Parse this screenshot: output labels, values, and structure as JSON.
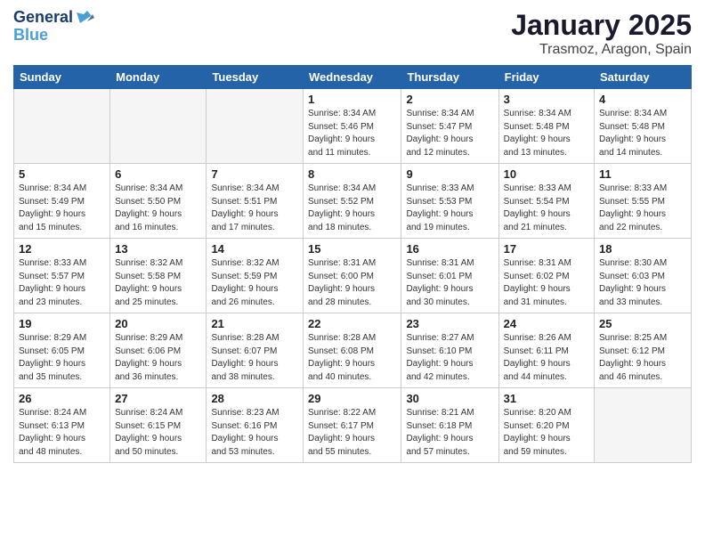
{
  "logo": {
    "line1": "General",
    "line2": "Blue"
  },
  "title": "January 2025",
  "subtitle": "Trasmoz, Aragon, Spain",
  "days_of_week": [
    "Sunday",
    "Monday",
    "Tuesday",
    "Wednesday",
    "Thursday",
    "Friday",
    "Saturday"
  ],
  "weeks": [
    [
      {
        "day": "",
        "info": ""
      },
      {
        "day": "",
        "info": ""
      },
      {
        "day": "",
        "info": ""
      },
      {
        "day": "1",
        "info": "Sunrise: 8:34 AM\nSunset: 5:46 PM\nDaylight: 9 hours\nand 11 minutes."
      },
      {
        "day": "2",
        "info": "Sunrise: 8:34 AM\nSunset: 5:47 PM\nDaylight: 9 hours\nand 12 minutes."
      },
      {
        "day": "3",
        "info": "Sunrise: 8:34 AM\nSunset: 5:48 PM\nDaylight: 9 hours\nand 13 minutes."
      },
      {
        "day": "4",
        "info": "Sunrise: 8:34 AM\nSunset: 5:48 PM\nDaylight: 9 hours\nand 14 minutes."
      }
    ],
    [
      {
        "day": "5",
        "info": "Sunrise: 8:34 AM\nSunset: 5:49 PM\nDaylight: 9 hours\nand 15 minutes."
      },
      {
        "day": "6",
        "info": "Sunrise: 8:34 AM\nSunset: 5:50 PM\nDaylight: 9 hours\nand 16 minutes."
      },
      {
        "day": "7",
        "info": "Sunrise: 8:34 AM\nSunset: 5:51 PM\nDaylight: 9 hours\nand 17 minutes."
      },
      {
        "day": "8",
        "info": "Sunrise: 8:34 AM\nSunset: 5:52 PM\nDaylight: 9 hours\nand 18 minutes."
      },
      {
        "day": "9",
        "info": "Sunrise: 8:33 AM\nSunset: 5:53 PM\nDaylight: 9 hours\nand 19 minutes."
      },
      {
        "day": "10",
        "info": "Sunrise: 8:33 AM\nSunset: 5:54 PM\nDaylight: 9 hours\nand 21 minutes."
      },
      {
        "day": "11",
        "info": "Sunrise: 8:33 AM\nSunset: 5:55 PM\nDaylight: 9 hours\nand 22 minutes."
      }
    ],
    [
      {
        "day": "12",
        "info": "Sunrise: 8:33 AM\nSunset: 5:57 PM\nDaylight: 9 hours\nand 23 minutes."
      },
      {
        "day": "13",
        "info": "Sunrise: 8:32 AM\nSunset: 5:58 PM\nDaylight: 9 hours\nand 25 minutes."
      },
      {
        "day": "14",
        "info": "Sunrise: 8:32 AM\nSunset: 5:59 PM\nDaylight: 9 hours\nand 26 minutes."
      },
      {
        "day": "15",
        "info": "Sunrise: 8:31 AM\nSunset: 6:00 PM\nDaylight: 9 hours\nand 28 minutes."
      },
      {
        "day": "16",
        "info": "Sunrise: 8:31 AM\nSunset: 6:01 PM\nDaylight: 9 hours\nand 30 minutes."
      },
      {
        "day": "17",
        "info": "Sunrise: 8:31 AM\nSunset: 6:02 PM\nDaylight: 9 hours\nand 31 minutes."
      },
      {
        "day": "18",
        "info": "Sunrise: 8:30 AM\nSunset: 6:03 PM\nDaylight: 9 hours\nand 33 minutes."
      }
    ],
    [
      {
        "day": "19",
        "info": "Sunrise: 8:29 AM\nSunset: 6:05 PM\nDaylight: 9 hours\nand 35 minutes."
      },
      {
        "day": "20",
        "info": "Sunrise: 8:29 AM\nSunset: 6:06 PM\nDaylight: 9 hours\nand 36 minutes."
      },
      {
        "day": "21",
        "info": "Sunrise: 8:28 AM\nSunset: 6:07 PM\nDaylight: 9 hours\nand 38 minutes."
      },
      {
        "day": "22",
        "info": "Sunrise: 8:28 AM\nSunset: 6:08 PM\nDaylight: 9 hours\nand 40 minutes."
      },
      {
        "day": "23",
        "info": "Sunrise: 8:27 AM\nSunset: 6:10 PM\nDaylight: 9 hours\nand 42 minutes."
      },
      {
        "day": "24",
        "info": "Sunrise: 8:26 AM\nSunset: 6:11 PM\nDaylight: 9 hours\nand 44 minutes."
      },
      {
        "day": "25",
        "info": "Sunrise: 8:25 AM\nSunset: 6:12 PM\nDaylight: 9 hours\nand 46 minutes."
      }
    ],
    [
      {
        "day": "26",
        "info": "Sunrise: 8:24 AM\nSunset: 6:13 PM\nDaylight: 9 hours\nand 48 minutes."
      },
      {
        "day": "27",
        "info": "Sunrise: 8:24 AM\nSunset: 6:15 PM\nDaylight: 9 hours\nand 50 minutes."
      },
      {
        "day": "28",
        "info": "Sunrise: 8:23 AM\nSunset: 6:16 PM\nDaylight: 9 hours\nand 53 minutes."
      },
      {
        "day": "29",
        "info": "Sunrise: 8:22 AM\nSunset: 6:17 PM\nDaylight: 9 hours\nand 55 minutes."
      },
      {
        "day": "30",
        "info": "Sunrise: 8:21 AM\nSunset: 6:18 PM\nDaylight: 9 hours\nand 57 minutes."
      },
      {
        "day": "31",
        "info": "Sunrise: 8:20 AM\nSunset: 6:20 PM\nDaylight: 9 hours\nand 59 minutes."
      },
      {
        "day": "",
        "info": ""
      }
    ]
  ]
}
